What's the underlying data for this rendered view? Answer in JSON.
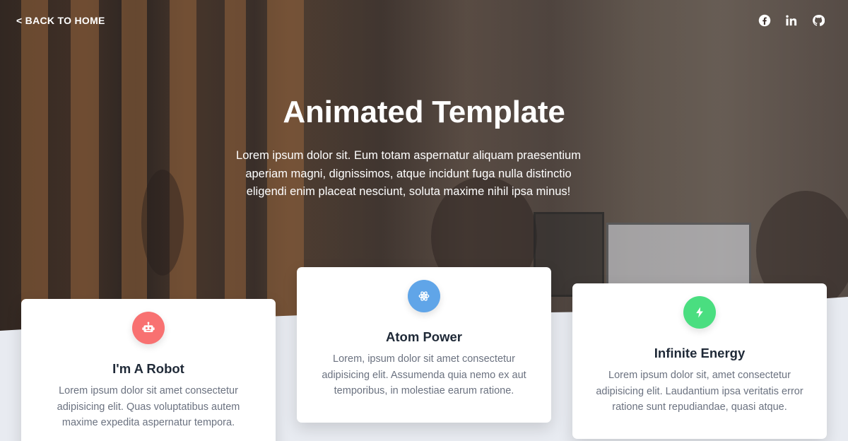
{
  "nav": {
    "back_label": "< BACK TO HOME",
    "socials": [
      {
        "name": "facebook-icon"
      },
      {
        "name": "linkedin-icon"
      },
      {
        "name": "github-icon"
      }
    ]
  },
  "hero": {
    "title": "Animated Template",
    "subtitle": "Lorem ipsum dolor sit. Eum totam aspernatur aliquam praesentium aperiam magni, dignissimos, atque incidunt fuga nulla distinctio eligendi enim placeat nesciunt, soluta maxime nihil ipsa minus!"
  },
  "cards": [
    {
      "icon": "robot-icon",
      "color": "#f87171",
      "title": "I'm A Robot",
      "text": "Lorem ipsum dolor sit amet consectetur adipisicing elit. Quas voluptatibus autem maxime expedita aspernatur tempora."
    },
    {
      "icon": "atom-icon",
      "color": "#60a5e8",
      "title": "Atom Power",
      "text": "Lorem, ipsum dolor sit amet consectetur adipisicing elit. Assumenda quia nemo ex aut temporibus, in molestiae earum ratione."
    },
    {
      "icon": "bolt-icon",
      "color": "#4ade80",
      "title": "Infinite Energy",
      "text": "Lorem ipsum dolor sit, amet consectetur adipisicing elit. Laudantium ipsa veritatis error ratione sunt repudiandae, quasi atque."
    }
  ]
}
